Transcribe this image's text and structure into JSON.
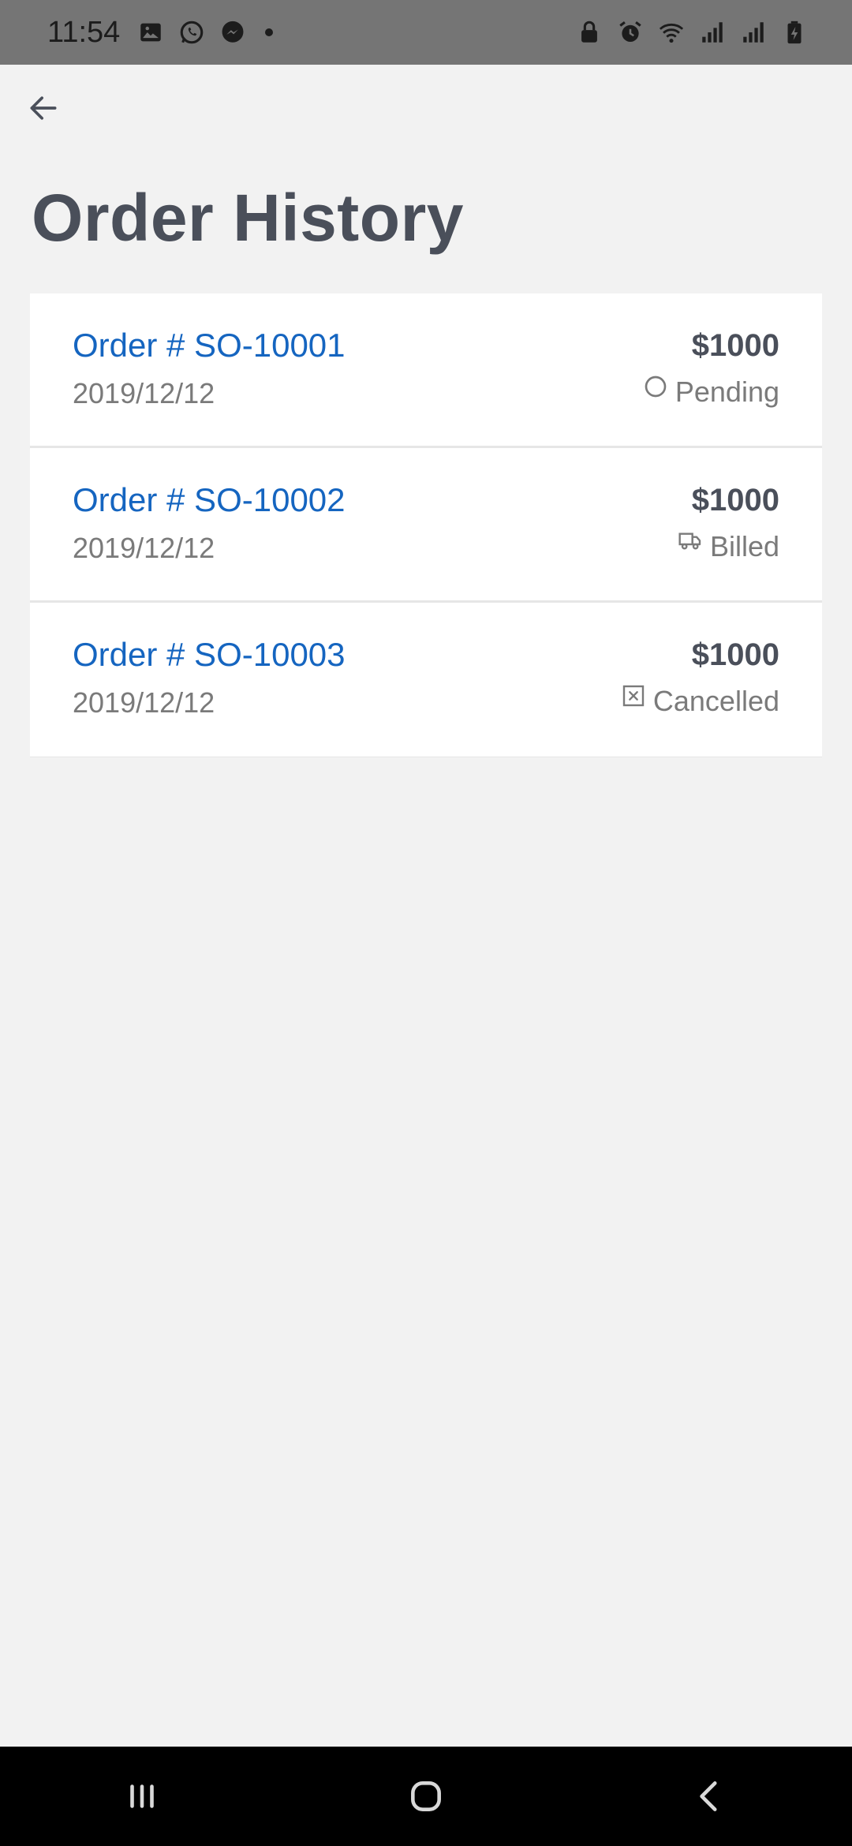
{
  "status_bar": {
    "time": "11:54",
    "left_icons": [
      "gallery-icon",
      "whatsapp-icon",
      "messenger-icon"
    ],
    "right_icons": [
      "lock-icon",
      "alarm-icon",
      "wifi-icon",
      "signal-icon",
      "signal-icon",
      "battery-icon"
    ]
  },
  "header": {
    "back_icon": "arrow-left-icon",
    "title": "Order History"
  },
  "orders": [
    {
      "id": "Order # SO-10001",
      "date": "2019/12/12",
      "amount": "$1000",
      "status": "Pending",
      "status_icon": "circle-icon"
    },
    {
      "id": "Order # SO-10002",
      "date": "2019/12/12",
      "amount": "$1000",
      "status": "Billed",
      "status_icon": "truck-icon"
    },
    {
      "id": "Order # SO-10003",
      "date": "2019/12/12",
      "amount": "$1000",
      "status": "Cancelled",
      "status_icon": "x-square-icon"
    }
  ],
  "nav_bar": {
    "buttons": [
      "recent-apps-icon",
      "home-icon",
      "back-icon"
    ]
  },
  "colors": {
    "accent": "#1565c0",
    "title": "#4a4f5a",
    "muted": "#7a7a7a",
    "background": "#f2f2f2",
    "status_bar": "#757575"
  }
}
